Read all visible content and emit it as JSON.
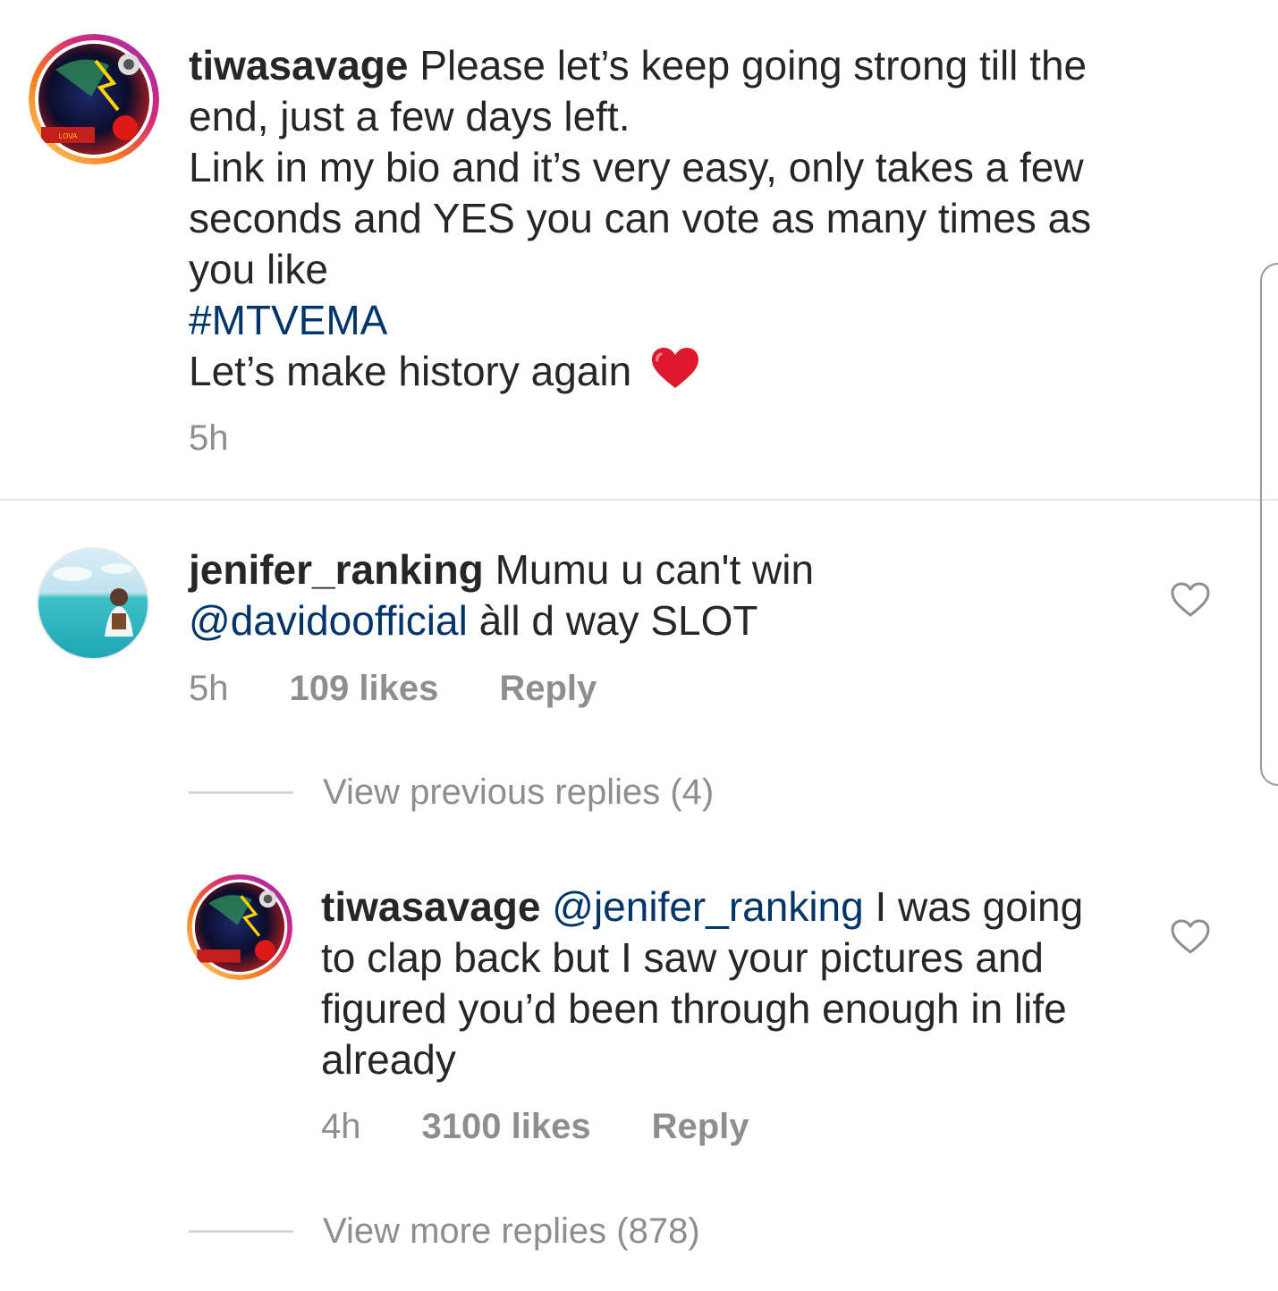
{
  "caption": {
    "username": "tiwasavage",
    "text_line1": "Please let’s keep going strong till the",
    "text_line2": "end, just a few days left.",
    "text_line3": "Link in my bio and it’s very easy, only takes a few",
    "text_line4": "seconds and YES you can vote as many times as",
    "text_line5": "you like",
    "hashtag": "#MTVEMA",
    "text_line7": "Let’s make history again",
    "time": "5h"
  },
  "comment": {
    "username": "jenifer_ranking",
    "text_part1": "Mumu u can't win",
    "mention": "@davidoofficial",
    "text_part2": " àll d way SLOT",
    "time": "5h",
    "likes": "109 likes",
    "reply_label": "Reply"
  },
  "view_previous_replies": "View previous replies (4)",
  "reply": {
    "username": "tiwasavage",
    "mention": "@jenifer_ranking",
    "text_part1": " I was going",
    "text_line2": "to clap back but I saw your pictures and",
    "text_line3": "figured you’d been through enough in life",
    "text_line4": "already",
    "time": "4h",
    "likes": "3100 likes",
    "reply_label": "Reply"
  },
  "view_more_replies": "View more replies (878)",
  "icons": {
    "caption_avatar": "avatar-icon",
    "comment_avatar": "avatar-icon",
    "heart": "heart-outline-icon",
    "emoji": "red-heart-emoji-icon"
  },
  "colors": {
    "link": "#003569",
    "meta": "#8e8e8e",
    "heart_emoji": "#e0182d"
  }
}
